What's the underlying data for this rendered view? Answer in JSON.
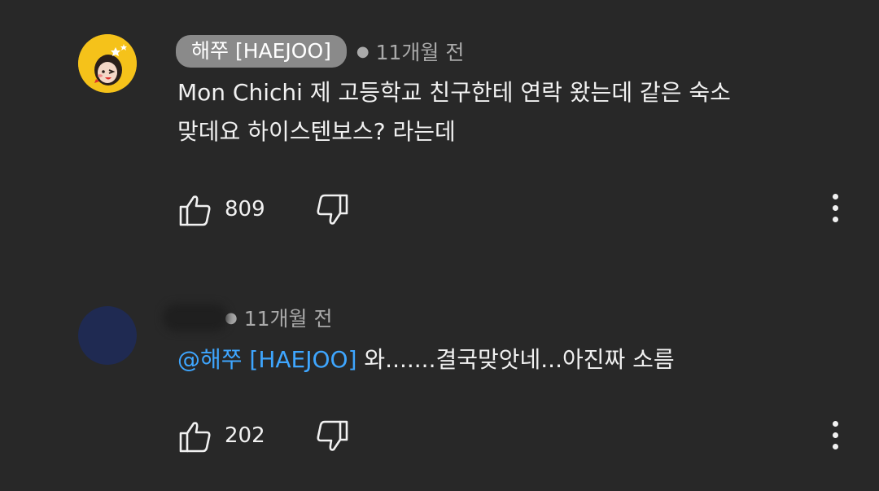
{
  "comments": [
    {
      "author": "해쭈 [HAEJOO]",
      "time": "11개월 전",
      "text": "Mon Chichi 제 고등학교 친구한테 연락 왔는데 같은 숙소\n맞데요 하이스텐보스? 라는데",
      "likes": "809",
      "avatar_color": "#f5c21a"
    },
    {
      "author": "",
      "time": "11개월 전",
      "mention": "@해쭈 [HAEJOO]",
      "text": " 와.......결국맞앗네...아진짜 소름",
      "likes": "202",
      "avatar_color": "#1f2a52"
    }
  ],
  "icons": {
    "like": "thumb-up-icon",
    "dislike": "thumb-down-icon",
    "more": "more-vert-icon"
  },
  "colors": {
    "background": "#282828",
    "mention": "#3ea6ff",
    "chip": "#8a8a8a"
  }
}
